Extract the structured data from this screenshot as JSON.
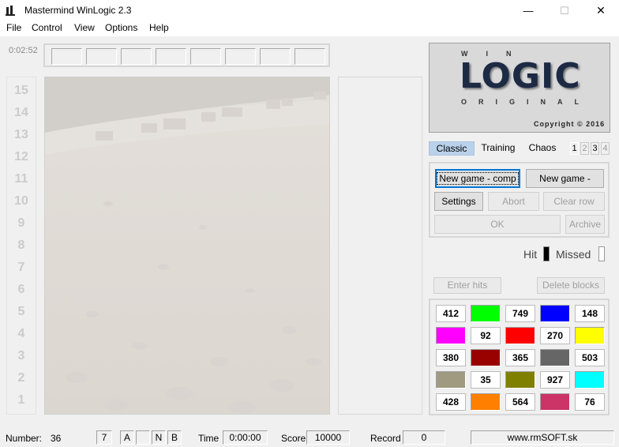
{
  "window": {
    "title": "Mastermind WinLogic 2.3",
    "minimize": "—",
    "maximize": "☐",
    "close": "✕"
  },
  "menu": [
    "File",
    "Control",
    "View",
    "Options",
    "Help"
  ],
  "timer": "0:02:52",
  "board": {
    "row_numbers": [
      "15",
      "14",
      "13",
      "12",
      "11",
      "10",
      "9",
      "8",
      "7",
      "6",
      "5",
      "4",
      "3",
      "2",
      "1"
    ]
  },
  "logo": {
    "win": "WIN",
    "logic": "LOGIC",
    "original": "ORIGINAL",
    "copyright": "Copyright © 2016"
  },
  "tabs": {
    "classic": "Classic",
    "training": "Training",
    "chaos": "Chaos",
    "levels": [
      "1",
      "2",
      "3",
      "4"
    ]
  },
  "buttons": {
    "new_game_comp": "New game - comp",
    "new_game_player": "New game - player",
    "settings": "Settings",
    "abort": "Abort",
    "clear_row": "Clear row",
    "ok": "OK",
    "archive": "Archive",
    "enter_hits": "Enter hits",
    "delete_blocks": "Delete blocks"
  },
  "hit_label": "Hit",
  "missed_label": "Missed",
  "palette": [
    {
      "type": "num",
      "value": "412"
    },
    {
      "type": "color",
      "color": "#00ff00"
    },
    {
      "type": "num",
      "value": "749"
    },
    {
      "type": "color",
      "color": "#0000ff"
    },
    {
      "type": "num",
      "value": "148"
    },
    {
      "type": "color",
      "color": "#ff00ff"
    },
    {
      "type": "num",
      "value": "92"
    },
    {
      "type": "color",
      "color": "#ff0000"
    },
    {
      "type": "num",
      "value": "270"
    },
    {
      "type": "color",
      "color": "#ffff00"
    },
    {
      "type": "num",
      "value": "380"
    },
    {
      "type": "color",
      "color": "#990000"
    },
    {
      "type": "num",
      "value": "365"
    },
    {
      "type": "color",
      "color": "#666666"
    },
    {
      "type": "num",
      "value": "503"
    },
    {
      "type": "color",
      "color": "#a09a80"
    },
    {
      "type": "num",
      "value": "35"
    },
    {
      "type": "color",
      "color": "#808000"
    },
    {
      "type": "num",
      "value": "927"
    },
    {
      "type": "color",
      "color": "#00ffff"
    },
    {
      "type": "num",
      "value": "428"
    },
    {
      "type": "color",
      "color": "#ff8000"
    },
    {
      "type": "num",
      "value": "564"
    },
    {
      "type": "color",
      "color": "#cc3366"
    },
    {
      "type": "num",
      "value": "76"
    }
  ],
  "status": {
    "number_label": "Number:",
    "number_value": "36",
    "field1": "7",
    "field2": "A",
    "field3": "",
    "field4": "N",
    "field5": "B",
    "time_label": "Time",
    "time_value": "0:00:00",
    "score_label": "Score",
    "score_value": "10000",
    "record_label": "Record",
    "record_value": "0",
    "website": "www.rmSOFT.sk"
  }
}
